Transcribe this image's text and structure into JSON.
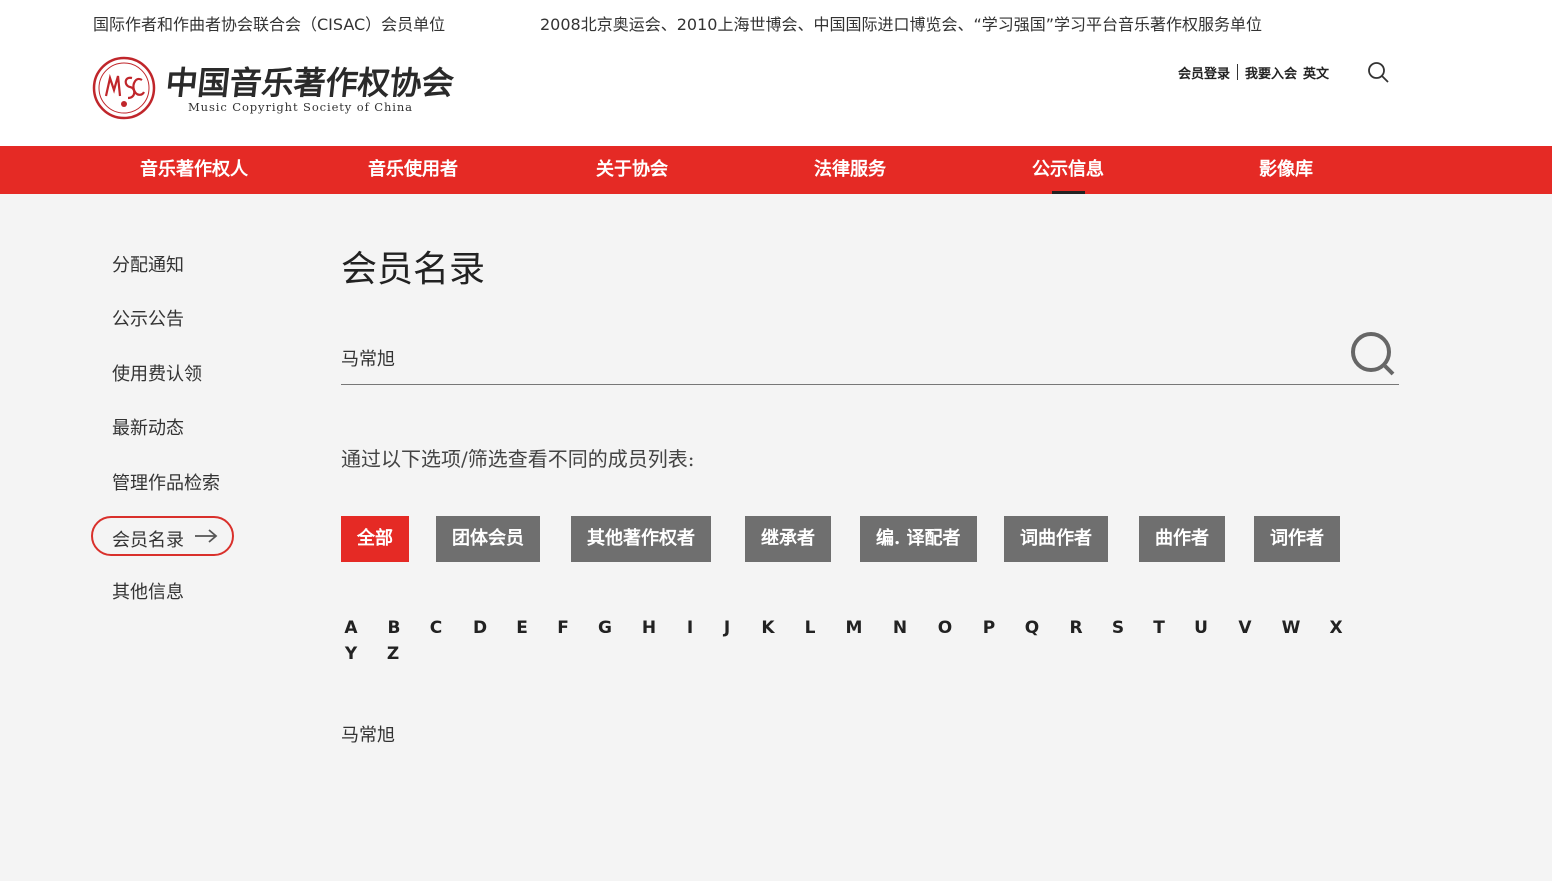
{
  "header": {
    "tagline_left": "国际作者和作曲者协会联合会（CISAC）会员单位",
    "tagline_right": "2008北京奥运会、2010上海世博会、中国国际进口博览会、“学习强国”学习平台音乐著作权服务单位",
    "logo": {
      "cn": "中国音乐著作权协会",
      "en": "Music Copyright Society of China",
      "emblem_icon": "mcsc-emblem-icon"
    },
    "links": {
      "login": "会员登录",
      "join": "我要入会",
      "lang": "英文"
    },
    "search_icon": "search-icon"
  },
  "nav": {
    "items": [
      {
        "label": "音乐著作权人"
      },
      {
        "label": "音乐使用者"
      },
      {
        "label": "关于协会"
      },
      {
        "label": "法律服务"
      },
      {
        "label": "公示信息",
        "active": true
      },
      {
        "label": "影像库"
      }
    ]
  },
  "sidebar": {
    "items": [
      {
        "label": "分配通知"
      },
      {
        "label": "公示公告"
      },
      {
        "label": "使用费认领"
      },
      {
        "label": "最新动态"
      },
      {
        "label": "管理作品检索"
      },
      {
        "label": "会员名录",
        "active": true
      },
      {
        "label": "其他信息"
      }
    ],
    "active_icon": "arrow-right-icon"
  },
  "main": {
    "title": "会员名录",
    "search": {
      "value": "马常旭",
      "placeholder": ""
    },
    "filter_hint": "通过以下选项/筛选查看不同的成员列表:",
    "filters": [
      {
        "label": "全部",
        "active": true
      },
      {
        "label": "团体会员"
      },
      {
        "label": "其他著作权者"
      },
      {
        "label": "继承者"
      },
      {
        "label": "编. 译配者"
      },
      {
        "label": "词曲作者"
      },
      {
        "label": "曲作者"
      },
      {
        "label": "词作者"
      }
    ],
    "letters": [
      "A",
      "B",
      "C",
      "D",
      "E",
      "F",
      "G",
      "H",
      "I",
      "J",
      "K",
      "L",
      "M",
      "N",
      "O",
      "P",
      "Q",
      "R",
      "S",
      "T",
      "U",
      "V",
      "W",
      "X",
      "Y",
      "Z"
    ],
    "results": [
      "马常旭"
    ]
  },
  "colors": {
    "brand_red": "#e52a25",
    "filter_gray": "#6f6f6f",
    "background": "#f4f4f4"
  }
}
